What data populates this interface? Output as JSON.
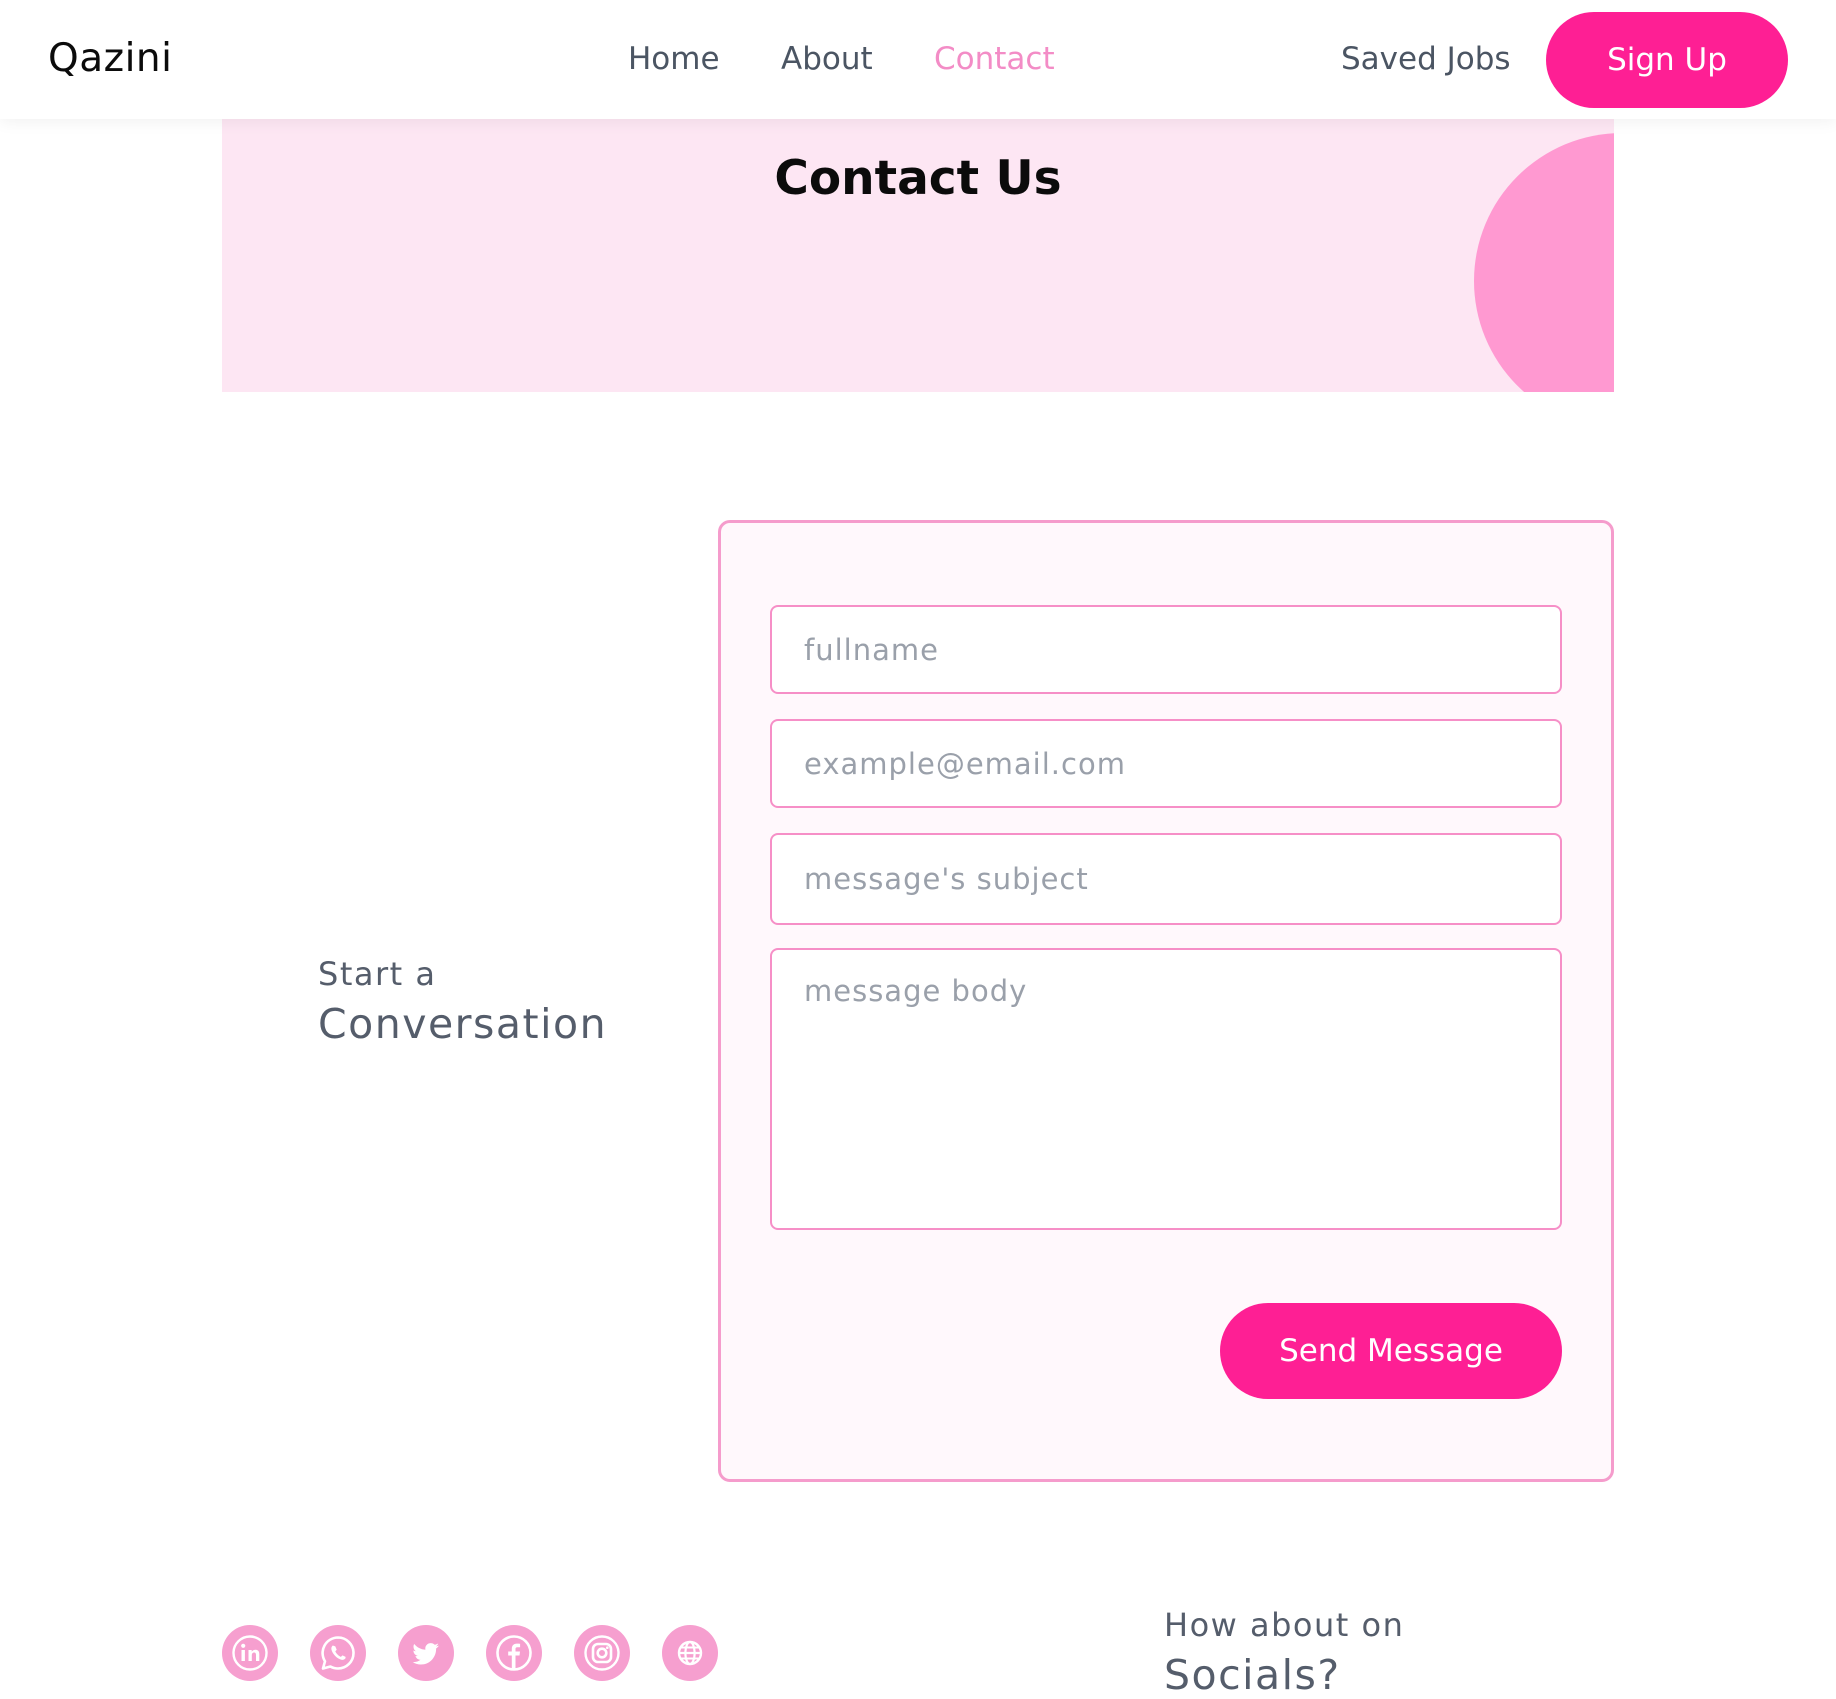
{
  "nav": {
    "brand": "Qazini",
    "links": [
      "Home",
      "About",
      "Contact"
    ],
    "active_link": "Contact",
    "saved_jobs": "Saved Jobs",
    "signup": "Sign Up"
  },
  "hero": {
    "title": "Contact Us"
  },
  "conversation": {
    "line1": "Start a",
    "line2": "Conversation"
  },
  "form": {
    "fullname_placeholder": "fullname",
    "email_placeholder": "example@email.com",
    "subject_placeholder": "message's subject",
    "body_placeholder": "message body",
    "send_label": "Send Message"
  },
  "socials": {
    "line1": "How about on",
    "line2": "Socials?",
    "icons": [
      "linkedin-icon",
      "whatsapp-icon",
      "twitter-icon",
      "facebook-icon",
      "instagram-icon",
      "globe-icon"
    ]
  },
  "colors": {
    "accent": "#fe1f94",
    "accent_light": "#f69fcf",
    "hero_bg": "#fde6f3",
    "active_link": "#f38cc6",
    "text_muted": "#555d6b"
  }
}
